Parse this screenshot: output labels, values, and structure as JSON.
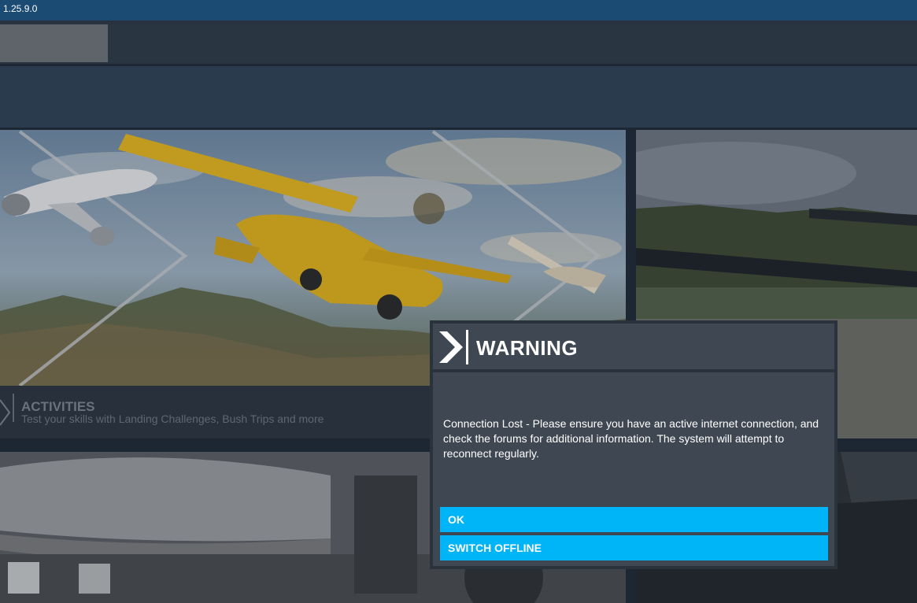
{
  "titlebar": {
    "version": "1.25.9.0"
  },
  "activities": {
    "title": "ACTIVITIES",
    "subtitle": "Test your skills with Landing Challenges, Bush Trips and more"
  },
  "dialog": {
    "title": "WARNING",
    "message": "Connection Lost - Please ensure you have an active internet connection, and check the forums for additional information. The system will attempt to reconnect regularly.",
    "buttons": {
      "ok": "OK",
      "switch_offline": "SWITCH OFFLINE"
    }
  },
  "colors": {
    "accent": "#00b4f8",
    "titlebar": "#1b4a72",
    "dialog_bg": "#3e4752"
  },
  "icons": [
    "chevron-right-icon"
  ]
}
